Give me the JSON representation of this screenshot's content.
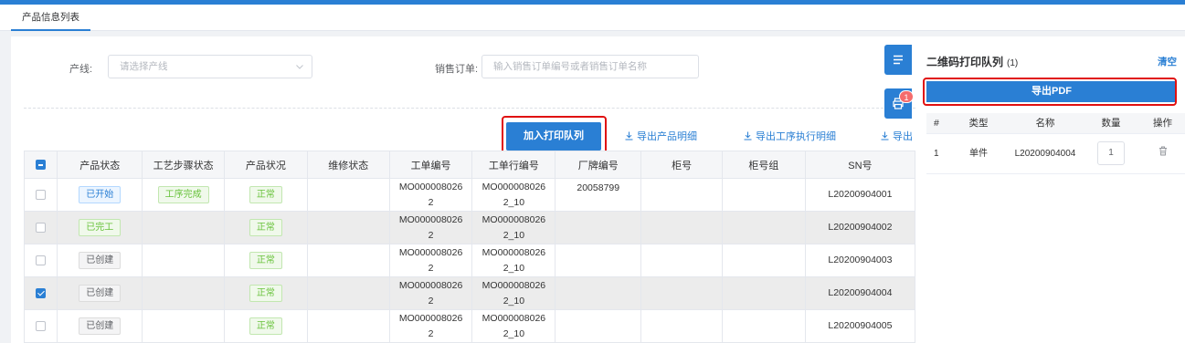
{
  "tab": {
    "label": "产品信息列表"
  },
  "filters": {
    "line_label": "产线:",
    "line_placeholder": "请选择产线",
    "order_label": "销售订单:",
    "order_placeholder": "输入销售订单编号或者销售订单名称"
  },
  "actions": {
    "add_queue": "加入打印队列",
    "export_detail": "导出产品明细",
    "export_process": "导出工序执行明细",
    "export_more": "导出"
  },
  "table": {
    "headers": [
      "产品状态",
      "工艺步骤状态",
      "产品状况",
      "维修状态",
      "工单编号",
      "工单行编号",
      "厂牌编号",
      "柜号",
      "柜号组",
      "SN号"
    ],
    "rows": [
      {
        "status": "已开始",
        "step": "工序完成",
        "condition": "正常",
        "repair": "",
        "wo_a": "MO000008026",
        "wo_b": "2",
        "line_a": "MO000008026",
        "line_b": "2_10",
        "brand": "20058799",
        "cabinet": "",
        "group": "",
        "sn": "L20200904001"
      },
      {
        "status": "已完工",
        "step": "",
        "condition": "正常",
        "repair": "",
        "wo_a": "MO000008026",
        "wo_b": "2",
        "line_a": "MO000008026",
        "line_b": "2_10",
        "brand": "",
        "cabinet": "",
        "group": "",
        "sn": "L20200904002"
      },
      {
        "status": "已创建",
        "step": "",
        "condition": "正常",
        "repair": "",
        "wo_a": "MO000008026",
        "wo_b": "2",
        "line_a": "MO000008026",
        "line_b": "2_10",
        "brand": "",
        "cabinet": "",
        "group": "",
        "sn": "L20200904003"
      },
      {
        "status": "已创建",
        "step": "",
        "condition": "正常",
        "repair": "",
        "wo_a": "MO000008026",
        "wo_b": "2",
        "line_a": "MO000008026",
        "line_b": "2_10",
        "brand": "",
        "cabinet": "",
        "group": "",
        "sn": "L20200904004"
      },
      {
        "status": "已创建",
        "step": "",
        "condition": "正常",
        "repair": "",
        "wo_a": "MO000008026",
        "wo_b": "2",
        "line_a": "MO000008026",
        "line_b": "2_10",
        "brand": "",
        "cabinet": "",
        "group": "",
        "sn": "L20200904005"
      }
    ]
  },
  "queue": {
    "title": "二维码打印队列",
    "count": "(1)",
    "clear": "清空",
    "export_pdf": "导出PDF",
    "badge": "1",
    "headers": [
      "#",
      "类型",
      "名称",
      "数量",
      "操作"
    ],
    "rows": [
      {
        "index": "1",
        "type": "单件",
        "name": "L20200904004",
        "qty": "1"
      }
    ]
  },
  "colors": {
    "accent": "#2a7fd4",
    "highlight": "#e01010"
  }
}
